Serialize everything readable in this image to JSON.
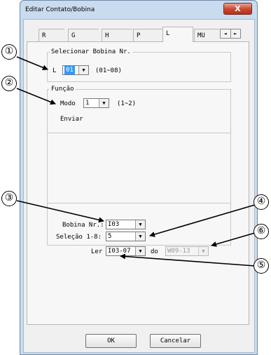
{
  "window": {
    "title": "Editar Contato/Bobina",
    "close_label": "X"
  },
  "tabs": [
    {
      "label": "R"
    },
    {
      "label": "G"
    },
    {
      "label": "H"
    },
    {
      "label": "P"
    },
    {
      "label": "L"
    },
    {
      "label": "MU"
    }
  ],
  "tab_scroll": {
    "left": "◄",
    "right": "►"
  },
  "section1": {
    "legend": "Selecionar Bobina Nr.",
    "prefix": "L",
    "value": "01",
    "range": "(01~08)"
  },
  "section2": {
    "legend": "Função",
    "mode_label": "Modo",
    "mode_value": "1",
    "mode_range": "(1~2)",
    "send_label": "Enviar"
  },
  "section3": {
    "coil_label": "Bobina Nr.:",
    "coil_value": "I03",
    "select_label": "Seleção 1-8:",
    "select_value": "5",
    "read_label": "Ler",
    "read_value": "I03-07",
    "do_label": "do",
    "do_value": "W09-13"
  },
  "buttons": {
    "ok": "OK",
    "cancel": "Cancelar"
  },
  "markers": [
    "①",
    "②",
    "③",
    "④",
    "⑤",
    "⑥"
  ],
  "dropdown_arrow": "▼"
}
